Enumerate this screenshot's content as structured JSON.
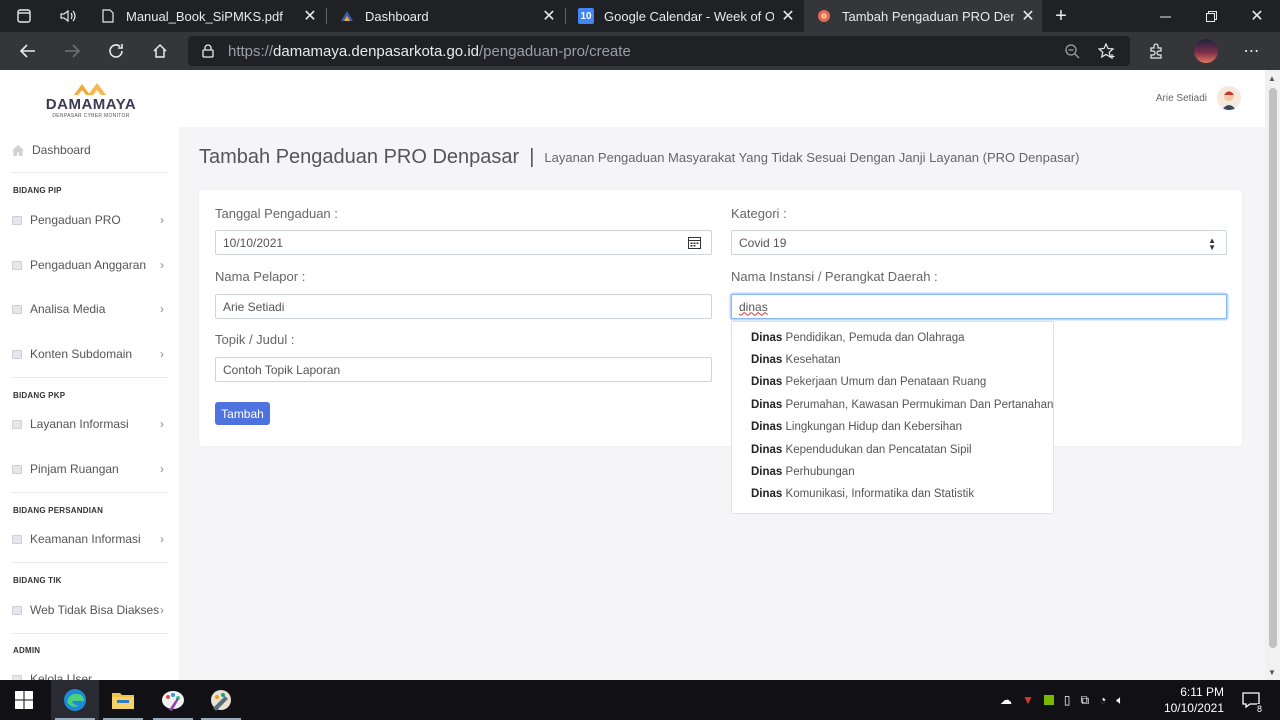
{
  "browser": {
    "tabs": [
      {
        "title": "Manual_Book_SiPMKS.pdf",
        "icon": "document-icon"
      },
      {
        "title": "Dashboard",
        "icon": "damamaya-icon"
      },
      {
        "title": "Google Calendar - Week of Octo",
        "icon": "calendar-icon",
        "badge": "10"
      },
      {
        "title": "Tambah Pengaduan PRO Denpas",
        "icon": "site-icon",
        "active": true
      }
    ],
    "url_prefix": "https://",
    "url_host": "damamaya.denpasarkota.go.id",
    "url_path": "/pengaduan-pro/create"
  },
  "header": {
    "logo_text": "DAMAMAYA",
    "logo_tagline": "DENPASAR CYBER MONITOR",
    "user_name": "Arie Setiadi"
  },
  "sidebar": {
    "dashboard": "Dashboard",
    "sections": [
      {
        "heading": "BIDANG PIP",
        "items": [
          "Pengaduan PRO",
          "Pengaduan Anggaran",
          "Analisa Media",
          "Konten Subdomain"
        ]
      },
      {
        "heading": "BIDANG PKP",
        "items": [
          "Layanan Informasi",
          "Pinjam Ruangan"
        ]
      },
      {
        "heading": "BIDANG PERSANDIAN",
        "items": [
          "Keamanan Informasi"
        ]
      },
      {
        "heading": "BIDANG TIK",
        "items": [
          "Web Tidak Bisa Diakses"
        ]
      },
      {
        "heading": "ADMIN",
        "items": [
          "Kelola User"
        ]
      }
    ]
  },
  "page": {
    "title": "Tambah Pengaduan PRO Denpasar",
    "separator": "|",
    "subtitle": "Layanan Pengaduan Masyarakat Yang Tidak Sesuai Dengan Janji Layanan (PRO Denpasar)"
  },
  "form": {
    "tanggal_label": "Tanggal Pengaduan :",
    "tanggal_value": "10/10/2021",
    "kategori_label": "Kategori :",
    "kategori_value": "Covid 19",
    "nama_label": "Nama Pelapor :",
    "nama_value": "Arie Setiadi",
    "instansi_label": "Nama Instansi / Perangkat Daerah :",
    "instansi_value": "dinas",
    "topik_label": "Topik / Judul :",
    "topik_value": "Contoh Topik Laporan",
    "submit_label": "Tambah"
  },
  "autocomplete": {
    "match": "Dinas",
    "suggestions": [
      " Pendidikan, Pemuda dan Olahraga",
      " Kesehatan",
      " Pekerjaan Umum dan Penataan Ruang",
      " Perumahan, Kawasan Permukiman Dan Pertanahan",
      " Lingkungan Hidup dan Kebersihan",
      " Kependudukan dan Pencatatan Sipil",
      " Perhubungan",
      " Komunikasi, Informatika dan Statistik"
    ]
  },
  "taskbar": {
    "time": "6:11 PM",
    "date": "10/10/2021",
    "notifications": "8"
  },
  "colors": {
    "accent": "#4e73df",
    "chrome_dark": "#202124",
    "chrome_mid": "#35363a",
    "page_bg": "#f5f5f7"
  }
}
